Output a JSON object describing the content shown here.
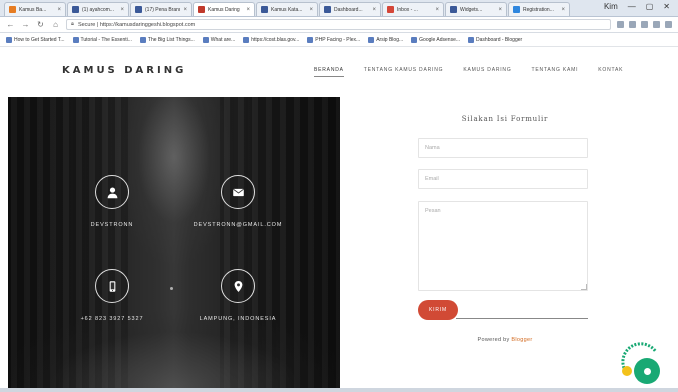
{
  "browser": {
    "tabs": [
      {
        "title": "Kamus Ba...",
        "color": "#e67c22"
      },
      {
        "title": "(1) ayahcom...",
        "color": "#3b5998"
      },
      {
        "title": "(17) Pena Brand...",
        "color": "#3b5998"
      },
      {
        "title": "Kamus Daring",
        "color": "#c0392b",
        "active": true
      },
      {
        "title": "Kamus Kata...",
        "color": "#3b5998"
      },
      {
        "title": "Dashboard...",
        "color": "#3b5998"
      },
      {
        "title": "Inbox - ...",
        "color": "#d44638"
      },
      {
        "title": "Widgets...",
        "color": "#3b5998"
      },
      {
        "title": "Registration...",
        "color": "#2e86de"
      }
    ],
    "window_user": "Kim",
    "url": "Secure | https://kamusdaringgeshi.blogspot.com",
    "bookmarks": [
      "How to Get Started T...",
      "Tutorial - The Essenti...",
      "The Big List Things...",
      "What are...",
      "https://cost.blas.gov...",
      "PHP Facing - Plex...",
      "Arsip Blog...",
      "Google Adsense...",
      "Dashboard - Blogger"
    ]
  },
  "site": {
    "logo": "KAMUS DARING",
    "nav": [
      {
        "label": "BERANDA",
        "active": true
      },
      {
        "label": "TENTANG KAMUS DARING",
        "active": false
      },
      {
        "label": "KAMUS DARING",
        "active": false
      },
      {
        "label": "TENTANG KAMI",
        "active": false
      },
      {
        "label": "KONTAK",
        "active": false
      }
    ]
  },
  "contact": {
    "items": [
      {
        "icon": "user-icon",
        "text": "DEVSTRONN"
      },
      {
        "icon": "envelope-icon",
        "text": "DEVSTRONN@GMAIL.COM"
      },
      {
        "icon": "phone-icon",
        "text": "+62 823 3927 5327"
      },
      {
        "icon": "map-marker-icon",
        "text": "LAMPUNG, INDONESIA"
      }
    ]
  },
  "form": {
    "title": "Silakan Isi Formulir",
    "name_placeholder": "Nama",
    "email_placeholder": "Email",
    "message_placeholder": "Pesan",
    "send_label": "KIRIM",
    "powered_prefix": "Powered by",
    "powered_brand": "Blogger"
  },
  "colors": {
    "accent": "#d14a35",
    "badge": "#19a974"
  }
}
